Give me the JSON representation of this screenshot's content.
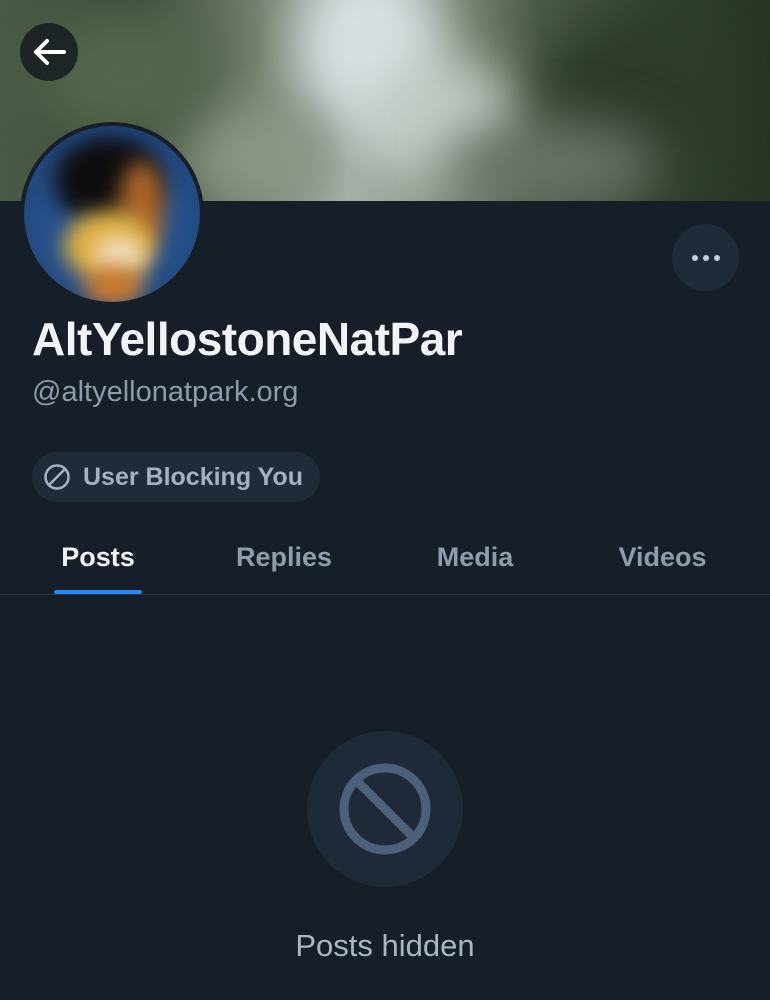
{
  "header": {
    "back_icon": "arrow-left-icon",
    "more_icon": "ellipsis-horizontal-icon"
  },
  "profile": {
    "display_name": "AltYellostoneNatPar",
    "handle": "@altyellonatpark.org",
    "blocking_status": {
      "icon": "prohibited-icon",
      "label": "User Blocking You"
    }
  },
  "tabs": [
    {
      "label": "Posts",
      "active": true
    },
    {
      "label": "Replies",
      "active": false
    },
    {
      "label": "Media",
      "active": false
    },
    {
      "label": "Videos",
      "active": false
    }
  ],
  "empty_state": {
    "icon": "prohibited-icon",
    "message": "Posts hidden"
  },
  "colors": {
    "background": "#161e27",
    "accent": "#208bfe",
    "pill_background": "#1f2b38",
    "muted_text": "#8c9cae"
  }
}
